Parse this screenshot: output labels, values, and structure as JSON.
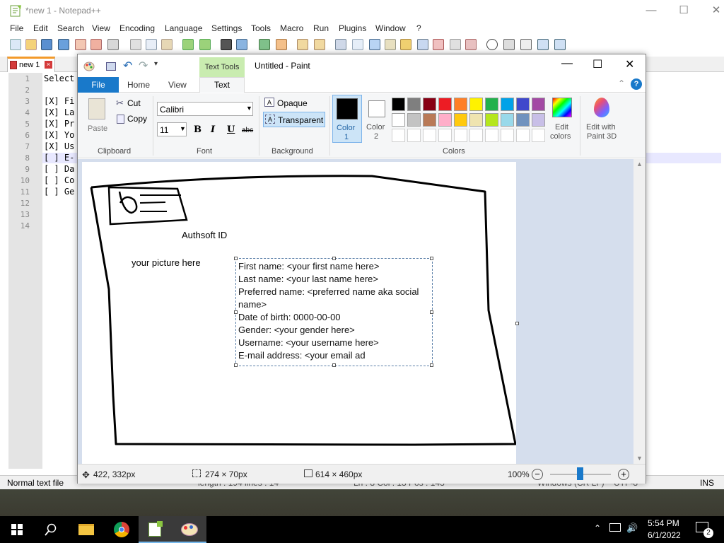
{
  "notepadpp": {
    "title": "*new 1 - Notepad++",
    "menu": [
      "File",
      "Edit",
      "Search",
      "View",
      "Encoding",
      "Language",
      "Settings",
      "Tools",
      "Macro",
      "Run",
      "Plugins",
      "Window",
      "?"
    ],
    "tab_label": "new 1",
    "line_numbers": [
      "1",
      "2",
      "3",
      "4",
      "5",
      "6",
      "7",
      "8",
      "9",
      "10",
      "11",
      "12",
      "13",
      "14"
    ],
    "code_lines": [
      "Select",
      "",
      "[X] Fi",
      "[X] La",
      "[X] Pr",
      "[X] Yo",
      "[X] Us",
      "[ ] E-",
      "[ ] Da",
      "[ ] Co",
      "[ ] Ge",
      "",
      "",
      ""
    ],
    "status_left": "Normal text file",
    "status_mid": "length : 194    lines : 14",
    "status_pos": "Ln : 8    Col : 13    Pos : 143",
    "status_eol": "Windows (CR LF)",
    "status_enc": "UTF-8",
    "status_ins": "INS"
  },
  "paint": {
    "title": "Untitled - Paint",
    "tabs": {
      "file": "File",
      "home": "Home",
      "view": "View",
      "text_tools": "Text Tools",
      "text": "Text"
    },
    "clipboard": {
      "paste": "Paste",
      "cut": "Cut",
      "copy": "Copy",
      "group": "Clipboard"
    },
    "font": {
      "family": "Calibri",
      "size": "11",
      "bold": "B",
      "italic": "I",
      "underline": "U",
      "strike": "abc",
      "group": "Font"
    },
    "background": {
      "opaque": "Opaque",
      "transparent": "Transparent",
      "group": "Background"
    },
    "color1": {
      "label": "Color",
      "num": "1"
    },
    "color2": {
      "label": "Color",
      "num": "2"
    },
    "edit_colors": {
      "line1": "Edit",
      "line2": "colors"
    },
    "paint3d": {
      "line1": "Edit with",
      "line2": "Paint 3D"
    },
    "colors_group": "Colors",
    "palette_row1": [
      "#000000",
      "#7f7f7f",
      "#880015",
      "#ed1c24",
      "#ff7f27",
      "#fff200",
      "#22b14c",
      "#00a2e8",
      "#3f48cc",
      "#a349a4"
    ],
    "palette_row2": [
      "#ffffff",
      "#c3c3c3",
      "#b97a57",
      "#ffaec9",
      "#ffc90e",
      "#efe4b0",
      "#b5e61d",
      "#99d9ea",
      "#7092be",
      "#c8bfe7"
    ],
    "canvas": {
      "label_id": "Authsoft ID",
      "label_picture": "your picture here",
      "textbox_lines": [
        "First name: <your first name here>",
        "Last name: <your last name here>",
        "Preferred name: <preferred name aka social",
        "name>",
        "Date of birth: 0000-00-00",
        "Gender: <your gender here>",
        "Username: <your username here>",
        "E-mail address: <your email ad"
      ]
    },
    "status": {
      "cursor": "422, 332px",
      "selection": "274 × 70px",
      "size": "614 × 460px",
      "zoom": "100%"
    }
  },
  "taskbar": {
    "time": "5:54 PM",
    "date": "6/1/2022",
    "notif_count": "2"
  }
}
